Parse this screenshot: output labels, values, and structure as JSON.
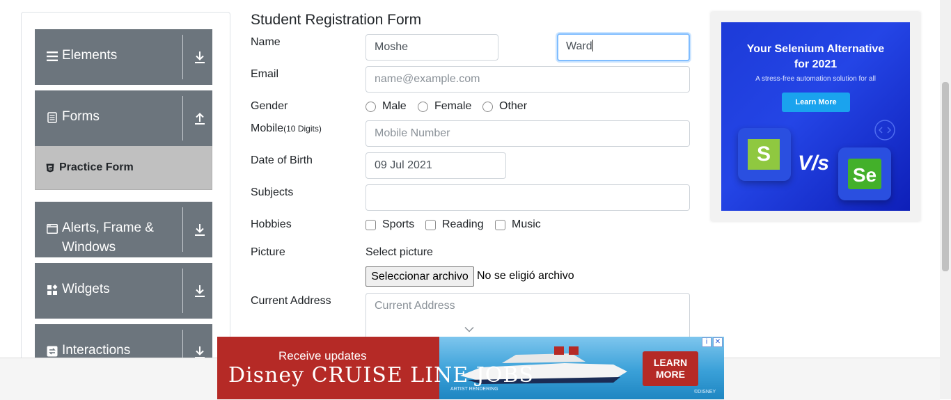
{
  "sidebar": {
    "groups": [
      {
        "label": "Elements",
        "icon": "hamburger-icon",
        "expanded": false
      },
      {
        "label": "Forms",
        "icon": "form-icon",
        "expanded": true
      },
      {
        "label": "Alerts, Frame &",
        "label2": "Windows",
        "icon": "window-icon",
        "expanded": false
      },
      {
        "label": "Widgets",
        "icon": "widgets-icon",
        "expanded": false
      },
      {
        "label": "Interactions",
        "icon": "interactions-icon",
        "expanded": false
      }
    ],
    "active_item": "Practice Form"
  },
  "form": {
    "title": "Student Registration Form",
    "name_label": "Name",
    "first_name": "Moshe",
    "last_name": "Ward",
    "email_label": "Email",
    "email_placeholder": "name@example.com",
    "gender_label": "Gender",
    "gender_options": [
      "Male",
      "Female",
      "Other"
    ],
    "mobile_label": "Mobile",
    "mobile_hint": "(10 Digits)",
    "mobile_placeholder": "Mobile Number",
    "dob_label": "Date of Birth",
    "dob_value": "09 Jul 2021",
    "subjects_label": "Subjects",
    "subjects_value": "",
    "hobbies_label": "Hobbies",
    "hobbies_options": [
      "Sports",
      "Reading",
      "Music"
    ],
    "picture_label": "Picture",
    "select_picture": "Select picture",
    "file_button": "Seleccionar archivo",
    "file_status": "No se eligió archivo",
    "address_label": "Current Address",
    "address_placeholder": "Current Address"
  },
  "ad_right": {
    "headline1": "Your Selenium Alternative",
    "headline2": "for 2021",
    "subline": "A stress-free automation solution for all",
    "button": "Learn More",
    "vs": "V/s",
    "tile_left": "S",
    "tile_right": "Se"
  },
  "ad_bottom": {
    "line1": "Receive updates",
    "line2": "Disney CRUISE LINE JOBS",
    "cta_line1": "LEARN",
    "cta_line2": "MORE",
    "caption": "ARTIST RENDERING",
    "brand": "©DISNEY",
    "info": "i",
    "close": "✕"
  },
  "colors": {
    "sidebar_group": "#6c757d",
    "active_item": "#c0c0c0",
    "focus_border": "#80bdff",
    "ad_blue": "#1d3bd8",
    "ad_red": "#b52a26"
  }
}
